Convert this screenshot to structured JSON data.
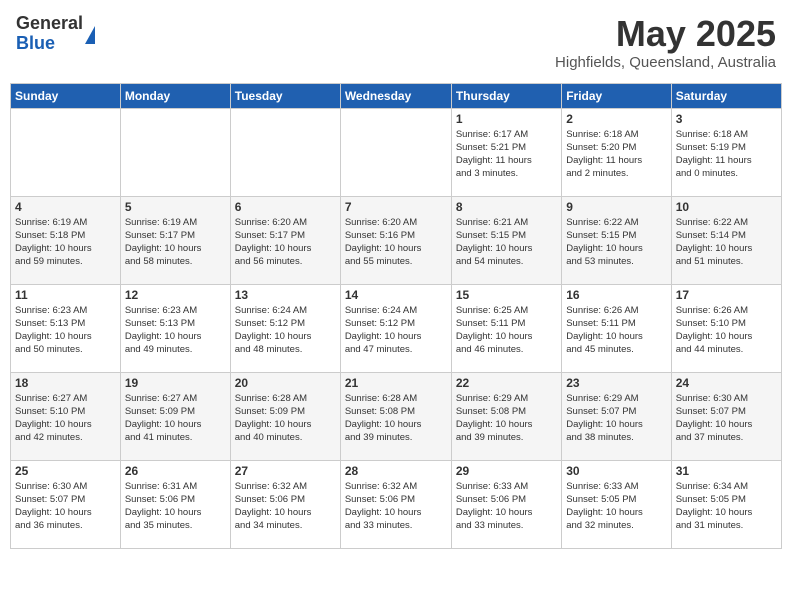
{
  "logo": {
    "general": "General",
    "blue": "Blue"
  },
  "title": "May 2025",
  "subtitle": "Highfields, Queensland, Australia",
  "days_of_week": [
    "Sunday",
    "Monday",
    "Tuesday",
    "Wednesday",
    "Thursday",
    "Friday",
    "Saturday"
  ],
  "weeks": [
    [
      {
        "num": "",
        "info": ""
      },
      {
        "num": "",
        "info": ""
      },
      {
        "num": "",
        "info": ""
      },
      {
        "num": "",
        "info": ""
      },
      {
        "num": "1",
        "info": "Sunrise: 6:17 AM\nSunset: 5:21 PM\nDaylight: 11 hours\nand 3 minutes."
      },
      {
        "num": "2",
        "info": "Sunrise: 6:18 AM\nSunset: 5:20 PM\nDaylight: 11 hours\nand 2 minutes."
      },
      {
        "num": "3",
        "info": "Sunrise: 6:18 AM\nSunset: 5:19 PM\nDaylight: 11 hours\nand 0 minutes."
      }
    ],
    [
      {
        "num": "4",
        "info": "Sunrise: 6:19 AM\nSunset: 5:18 PM\nDaylight: 10 hours\nand 59 minutes."
      },
      {
        "num": "5",
        "info": "Sunrise: 6:19 AM\nSunset: 5:17 PM\nDaylight: 10 hours\nand 58 minutes."
      },
      {
        "num": "6",
        "info": "Sunrise: 6:20 AM\nSunset: 5:17 PM\nDaylight: 10 hours\nand 56 minutes."
      },
      {
        "num": "7",
        "info": "Sunrise: 6:20 AM\nSunset: 5:16 PM\nDaylight: 10 hours\nand 55 minutes."
      },
      {
        "num": "8",
        "info": "Sunrise: 6:21 AM\nSunset: 5:15 PM\nDaylight: 10 hours\nand 54 minutes."
      },
      {
        "num": "9",
        "info": "Sunrise: 6:22 AM\nSunset: 5:15 PM\nDaylight: 10 hours\nand 53 minutes."
      },
      {
        "num": "10",
        "info": "Sunrise: 6:22 AM\nSunset: 5:14 PM\nDaylight: 10 hours\nand 51 minutes."
      }
    ],
    [
      {
        "num": "11",
        "info": "Sunrise: 6:23 AM\nSunset: 5:13 PM\nDaylight: 10 hours\nand 50 minutes."
      },
      {
        "num": "12",
        "info": "Sunrise: 6:23 AM\nSunset: 5:13 PM\nDaylight: 10 hours\nand 49 minutes."
      },
      {
        "num": "13",
        "info": "Sunrise: 6:24 AM\nSunset: 5:12 PM\nDaylight: 10 hours\nand 48 minutes."
      },
      {
        "num": "14",
        "info": "Sunrise: 6:24 AM\nSunset: 5:12 PM\nDaylight: 10 hours\nand 47 minutes."
      },
      {
        "num": "15",
        "info": "Sunrise: 6:25 AM\nSunset: 5:11 PM\nDaylight: 10 hours\nand 46 minutes."
      },
      {
        "num": "16",
        "info": "Sunrise: 6:26 AM\nSunset: 5:11 PM\nDaylight: 10 hours\nand 45 minutes."
      },
      {
        "num": "17",
        "info": "Sunrise: 6:26 AM\nSunset: 5:10 PM\nDaylight: 10 hours\nand 44 minutes."
      }
    ],
    [
      {
        "num": "18",
        "info": "Sunrise: 6:27 AM\nSunset: 5:10 PM\nDaylight: 10 hours\nand 42 minutes."
      },
      {
        "num": "19",
        "info": "Sunrise: 6:27 AM\nSunset: 5:09 PM\nDaylight: 10 hours\nand 41 minutes."
      },
      {
        "num": "20",
        "info": "Sunrise: 6:28 AM\nSunset: 5:09 PM\nDaylight: 10 hours\nand 40 minutes."
      },
      {
        "num": "21",
        "info": "Sunrise: 6:28 AM\nSunset: 5:08 PM\nDaylight: 10 hours\nand 39 minutes."
      },
      {
        "num": "22",
        "info": "Sunrise: 6:29 AM\nSunset: 5:08 PM\nDaylight: 10 hours\nand 39 minutes."
      },
      {
        "num": "23",
        "info": "Sunrise: 6:29 AM\nSunset: 5:07 PM\nDaylight: 10 hours\nand 38 minutes."
      },
      {
        "num": "24",
        "info": "Sunrise: 6:30 AM\nSunset: 5:07 PM\nDaylight: 10 hours\nand 37 minutes."
      }
    ],
    [
      {
        "num": "25",
        "info": "Sunrise: 6:30 AM\nSunset: 5:07 PM\nDaylight: 10 hours\nand 36 minutes."
      },
      {
        "num": "26",
        "info": "Sunrise: 6:31 AM\nSunset: 5:06 PM\nDaylight: 10 hours\nand 35 minutes."
      },
      {
        "num": "27",
        "info": "Sunrise: 6:32 AM\nSunset: 5:06 PM\nDaylight: 10 hours\nand 34 minutes."
      },
      {
        "num": "28",
        "info": "Sunrise: 6:32 AM\nSunset: 5:06 PM\nDaylight: 10 hours\nand 33 minutes."
      },
      {
        "num": "29",
        "info": "Sunrise: 6:33 AM\nSunset: 5:06 PM\nDaylight: 10 hours\nand 33 minutes."
      },
      {
        "num": "30",
        "info": "Sunrise: 6:33 AM\nSunset: 5:05 PM\nDaylight: 10 hours\nand 32 minutes."
      },
      {
        "num": "31",
        "info": "Sunrise: 6:34 AM\nSunset: 5:05 PM\nDaylight: 10 hours\nand 31 minutes."
      }
    ]
  ]
}
